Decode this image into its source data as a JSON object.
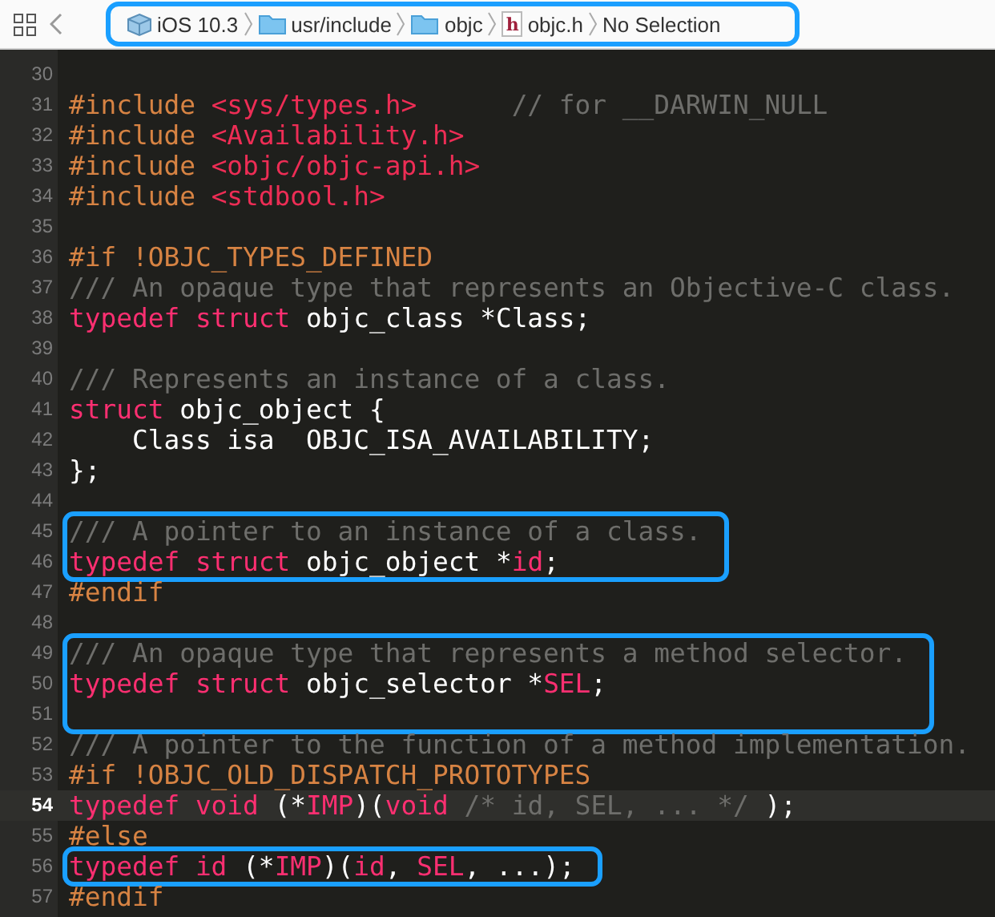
{
  "breadcrumb": {
    "boxed": true,
    "items": [
      {
        "label": "iOS 10.3",
        "kind": "sdk"
      },
      {
        "label": "usr/include",
        "kind": "folder"
      },
      {
        "label": "objc",
        "kind": "folder"
      },
      {
        "label": "objc.h",
        "kind": "file",
        "badge": "h"
      },
      {
        "label": "No Selection",
        "kind": "plain"
      }
    ]
  },
  "blocks": [
    {
      "boxed": false,
      "lines": [
        {
          "number": "30",
          "current": false
        },
        {
          "number": "31",
          "current": false,
          "tokens": [
            {
              "kind": "preproc",
              "text": "#include "
            },
            {
              "kind": "string",
              "text": "<sys/types.h>"
            },
            {
              "kind": "comment",
              "text": "      // for __DARWIN_NULL"
            }
          ]
        },
        {
          "number": "32",
          "current": false,
          "tokens": [
            {
              "kind": "preproc",
              "text": "#include "
            },
            {
              "kind": "string",
              "text": "<Availability.h>"
            }
          ]
        },
        {
          "number": "33",
          "current": false,
          "tokens": [
            {
              "kind": "preproc",
              "text": "#include "
            },
            {
              "kind": "string",
              "text": "<objc/objc-api.h>"
            }
          ]
        },
        {
          "number": "34",
          "current": false,
          "tokens": [
            {
              "kind": "preproc",
              "text": "#include "
            },
            {
              "kind": "string",
              "text": "<stdbool.h>"
            }
          ]
        },
        {
          "number": "35",
          "current": false
        },
        {
          "number": "36",
          "current": false,
          "tokens": [
            {
              "kind": "preproc",
              "text": "#if !OBJC_TYPES_DEFINED"
            }
          ]
        },
        {
          "number": "37",
          "current": false,
          "tokens": [
            {
              "kind": "comment",
              "text": "/// An opaque type that represents an Objective-C class."
            }
          ]
        },
        {
          "number": "38",
          "current": false,
          "tokens": [
            {
              "kind": "keyword",
              "text": "typedef struct "
            },
            {
              "kind": "plain",
              "text": "objc_class *Class;"
            }
          ]
        },
        {
          "number": "39",
          "current": false
        },
        {
          "number": "40",
          "current": false,
          "tokens": [
            {
              "kind": "comment",
              "text": "/// Represents an instance of a class."
            }
          ]
        },
        {
          "number": "41",
          "current": false,
          "tokens": [
            {
              "kind": "keyword",
              "text": "struct "
            },
            {
              "kind": "plain",
              "text": "objc_object {"
            }
          ]
        },
        {
          "number": "42",
          "current": false,
          "tokens": [
            {
              "kind": "plain",
              "text": "    Class isa  OBJC_ISA_AVAILABILITY;"
            }
          ]
        },
        {
          "number": "43",
          "current": false,
          "tokens": [
            {
              "kind": "plain",
              "text": "};"
            }
          ]
        },
        {
          "number": "44",
          "current": false
        }
      ]
    },
    {
      "boxed": true,
      "lines": [
        {
          "number": "45",
          "current": false,
          "tokens": [
            {
              "kind": "comment",
              "text": "/// A pointer to an instance of a class."
            }
          ]
        },
        {
          "number": "46",
          "current": false,
          "tokens": [
            {
              "kind": "keyword",
              "text": "typedef struct "
            },
            {
              "kind": "plain",
              "text": "objc_object *"
            },
            {
              "kind": "keyword",
              "text": "id"
            },
            {
              "kind": "plain",
              "text": ";"
            }
          ]
        }
      ]
    },
    {
      "boxed": false,
      "lines": [
        {
          "number": "47",
          "current": false,
          "tokens": [
            {
              "kind": "preproc",
              "text": "#endif"
            }
          ]
        },
        {
          "number": "48",
          "current": false
        }
      ]
    },
    {
      "boxed": true,
      "lines": [
        {
          "number": "49",
          "current": false,
          "tokens": [
            {
              "kind": "comment",
              "text": "/// An opaque type that represents a method selector."
            }
          ]
        },
        {
          "number": "50",
          "current": false,
          "tokens": [
            {
              "kind": "keyword",
              "text": "typedef struct "
            },
            {
              "kind": "plain",
              "text": "objc_selector *"
            },
            {
              "kind": "keyword",
              "text": "SEL"
            },
            {
              "kind": "plain",
              "text": ";"
            }
          ]
        },
        {
          "number": "51",
          "current": false
        }
      ]
    },
    {
      "boxed": false,
      "lines": [
        {
          "number": "52",
          "current": false,
          "tokens": [
            {
              "kind": "comment",
              "text": "/// A pointer to the function of a method implementation."
            }
          ]
        },
        {
          "number": "53",
          "current": false,
          "tokens": [
            {
              "kind": "preproc",
              "text": "#if !OBJC_OLD_DISPATCH_PROTOTYPES"
            }
          ]
        },
        {
          "number": "54",
          "current": true,
          "tokens": [
            {
              "kind": "keyword",
              "text": "typedef void "
            },
            {
              "kind": "plain",
              "text": "(*"
            },
            {
              "kind": "keyword",
              "text": "IMP"
            },
            {
              "kind": "plain",
              "text": ")("
            },
            {
              "kind": "keyword",
              "text": "void "
            },
            {
              "kind": "comment",
              "text": "/* id, SEL, ... */"
            },
            {
              "kind": "plain",
              "text": " );"
            }
          ]
        },
        {
          "number": "55",
          "current": false,
          "tokens": [
            {
              "kind": "preproc",
              "text": "#else"
            }
          ]
        }
      ]
    },
    {
      "boxed": true,
      "lines": [
        {
          "number": "56",
          "current": false,
          "tokens": [
            {
              "kind": "keyword",
              "text": "typedef id "
            },
            {
              "kind": "plain",
              "text": "(*"
            },
            {
              "kind": "keyword",
              "text": "IMP"
            },
            {
              "kind": "plain",
              "text": ")("
            },
            {
              "kind": "keyword",
              "text": "id"
            },
            {
              "kind": "plain",
              "text": ", "
            },
            {
              "kind": "keyword",
              "text": "SEL"
            },
            {
              "kind": "plain",
              "text": ", ...);"
            }
          ]
        }
      ]
    },
    {
      "boxed": false,
      "lines": [
        {
          "number": "57",
          "current": false,
          "tokens": [
            {
              "kind": "preproc",
              "text": "#endif"
            }
          ]
        }
      ]
    }
  ]
}
